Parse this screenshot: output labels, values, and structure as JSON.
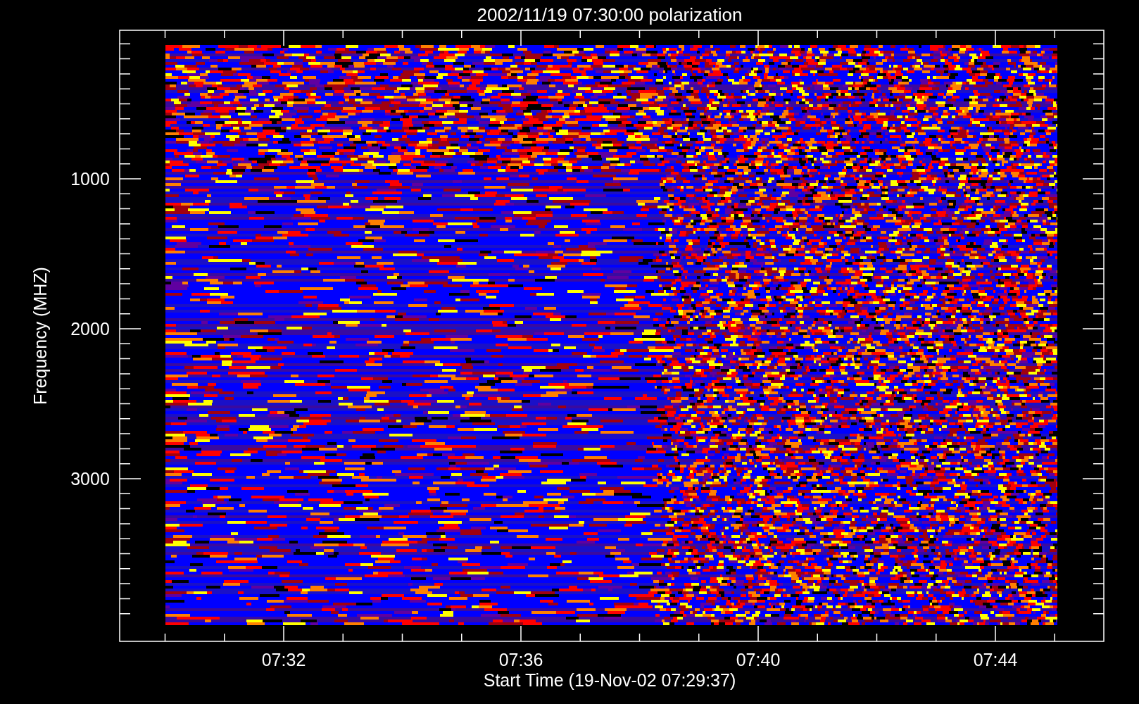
{
  "title": "2002/11/19 07:30:00 polarization",
  "y_axis": {
    "label": "Frequency (MHZ)",
    "tick_labels": [
      "1000",
      "2000",
      "3000"
    ]
  },
  "x_axis": {
    "label": "Start Time (19-Nov-02 07:29:37)",
    "tick_labels": [
      "07:32",
      "07:36",
      "07:40",
      "07:44"
    ]
  }
}
